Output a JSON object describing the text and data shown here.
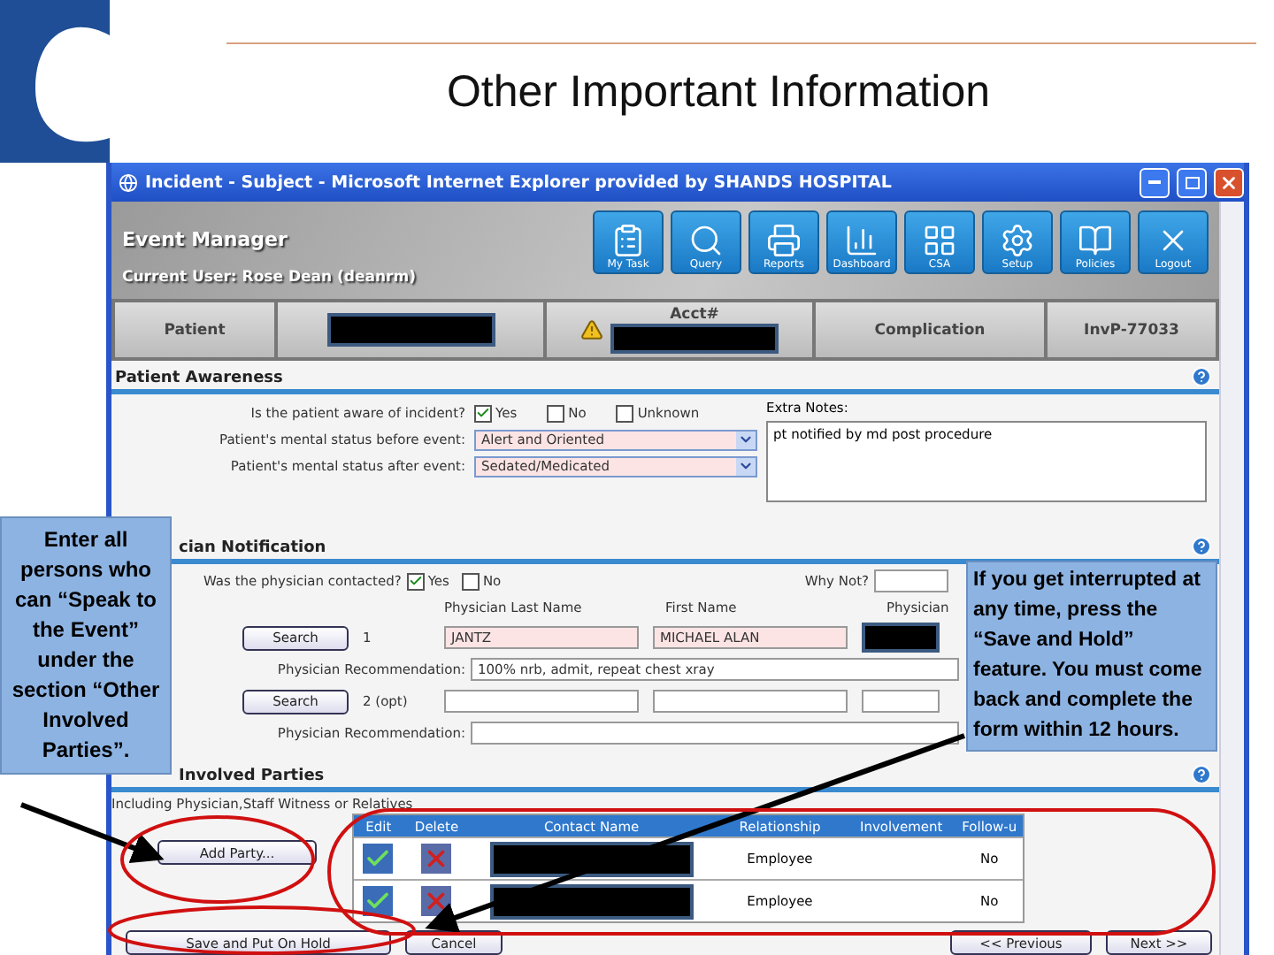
{
  "slide": {
    "title": "Other Important Information"
  },
  "window": {
    "title": "Incident - Subject - Microsoft Internet Explorer provided by SHANDS HOSPITAL"
  },
  "app": {
    "name": "Event Manager",
    "current_user": "Current User: Rose Dean (deanrm)"
  },
  "toolbar": [
    {
      "label": "My Task"
    },
    {
      "label": "Query"
    },
    {
      "label": "Reports"
    },
    {
      "label": "Dashboard"
    },
    {
      "label": "CSA"
    },
    {
      "label": "Setup"
    },
    {
      "label": "Policies"
    },
    {
      "label": "Logout"
    }
  ],
  "patient_bar": {
    "label": "Patient",
    "acct_label": "Acct#",
    "complication": "Complication",
    "inv": "InvP-77033"
  },
  "awareness": {
    "heading": "Patient Awareness",
    "question": "Is the patient aware of incident?",
    "options": [
      {
        "label": "Yes",
        "checked": true
      },
      {
        "label": "No",
        "checked": false
      },
      {
        "label": "Unknown",
        "checked": false
      }
    ],
    "before_label": "Patient's mental status before event:",
    "before_value": "Alert and Oriented",
    "after_label": "Patient's mental status after event:",
    "after_value": "Sedated/Medicated",
    "notes_label": "Extra Notes:",
    "notes_value": "pt notified by md post procedure"
  },
  "physician": {
    "heading": "cian Notification",
    "question": "Was the physician contacted?",
    "options": [
      {
        "label": "Yes",
        "checked": true
      },
      {
        "label": "No",
        "checked": false
      }
    ],
    "why_label": "Why Not?",
    "columns": [
      "Physician Last Name",
      "First Name",
      "Physician"
    ],
    "rows": [
      {
        "search": "Search",
        "number": "1",
        "last": "JANTZ",
        "first": "MICHAEL ALAN",
        "rec_label": "Physician Recommendation:",
        "rec": "100% nrb, admit, repeat chest xray"
      },
      {
        "search": "Search",
        "number": "2 (opt)",
        "last": "",
        "first": "",
        "rec_label": "Physician Recommendation:",
        "rec": ""
      }
    ]
  },
  "involved": {
    "heading": "Involved Parties",
    "subtitle": "Including Physician,Staff Witness or Relatives",
    "add_button": "Add Party...",
    "columns": [
      "Edit",
      "Delete",
      "Contact Name",
      "Relationship",
      "Involvement",
      "Follow-u"
    ],
    "rows": [
      {
        "relationship": "Employee",
        "followup": "No"
      },
      {
        "relationship": "Employee",
        "followup": "No"
      }
    ]
  },
  "buttons": {
    "save": "Save and Put On Hold",
    "cancel": "Cancel",
    "previous": "<< Previous",
    "next": "Next >>"
  },
  "callouts": [
    {
      "text": "Enter all persons who can “Speak to the Event” under the section “Other Involved Parties”."
    },
    {
      "text": "If you get interrupted at any time, press the “Save and Hold” feature. You must come back and complete the form within 12 hours."
    }
  ]
}
